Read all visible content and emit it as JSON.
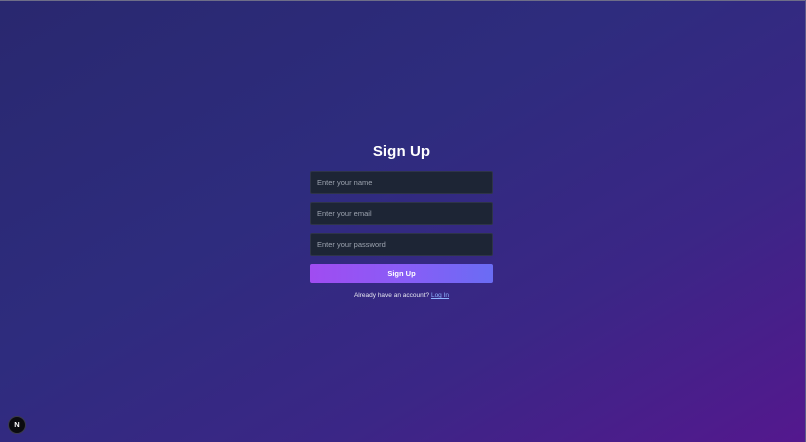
{
  "signup": {
    "title": "Sign Up",
    "name_placeholder": "Enter your name",
    "email_placeholder": "Enter your email",
    "password_placeholder": "Enter your password",
    "submit_label": "Sign Up",
    "footer_text": "Already have an account?",
    "login_link": "Log In"
  },
  "dev_badge": {
    "letter": "N",
    "icon": "nextjs-logo-icon"
  },
  "colors": {
    "background_start": "#29286f",
    "background_end": "#54188e",
    "input_bg": "#1d2535",
    "button_start": "#a04cf1",
    "button_end": "#6a6cf4",
    "link": "#8fb4ff"
  }
}
